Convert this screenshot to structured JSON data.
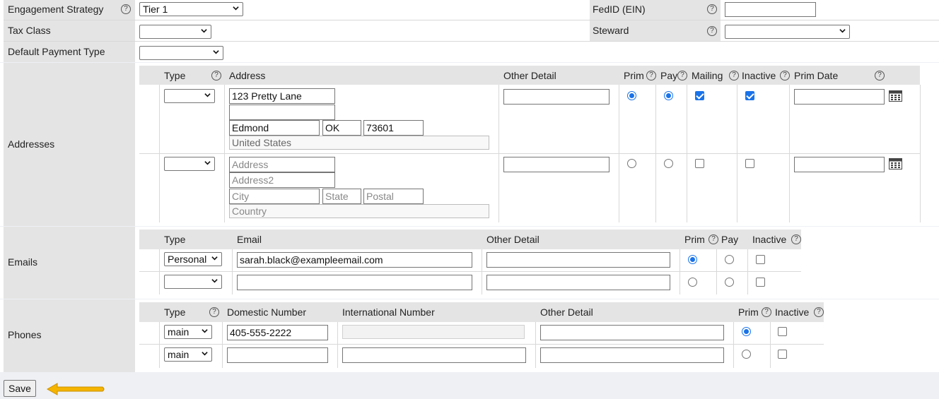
{
  "fields": {
    "engagement_strategy": {
      "label": "Engagement Strategy",
      "value": "Tier 1"
    },
    "tax_class": {
      "label": "Tax Class",
      "value": ""
    },
    "default_payment_type": {
      "label": "Default Payment Type",
      "value": ""
    },
    "fed_id": {
      "label": "FedID (EIN)",
      "value": ""
    },
    "steward": {
      "label": "Steward",
      "value": ""
    }
  },
  "help_glyph": "?",
  "addresses": {
    "label": "Addresses",
    "headers": {
      "type": "Type",
      "address": "Address",
      "other": "Other Detail",
      "prim": "Prim",
      "pay": "Pay",
      "mailing": "Mailing",
      "inactive": "Inactive",
      "prim_date": "Prim Date"
    },
    "rows": [
      {
        "type": "",
        "address": "123 Pretty Lane",
        "address2": "",
        "city": "Edmond",
        "state": "OK",
        "postal": "73601",
        "country": "United States",
        "other": "",
        "prim": true,
        "pay": true,
        "mailing": true,
        "inactive": true,
        "prim_date": ""
      },
      {
        "type": "",
        "address": "",
        "address2": "",
        "city": "",
        "state": "",
        "postal": "",
        "country": "",
        "other": "",
        "prim": false,
        "pay": false,
        "mailing": false,
        "inactive": false,
        "prim_date": ""
      }
    ],
    "placeholders": {
      "address": "Address",
      "address2": "Address2",
      "city": "City",
      "state": "State",
      "postal": "Postal",
      "country": "Country"
    }
  },
  "emails": {
    "label": "Emails",
    "headers": {
      "type": "Type",
      "email": "Email",
      "other": "Other Detail",
      "prim": "Prim",
      "pay": "Pay",
      "inactive": "Inactive"
    },
    "rows": [
      {
        "type": "Personal",
        "email": "sarah.black@exampleemail.com",
        "other": "",
        "prim": true,
        "pay": false,
        "inactive": false
      },
      {
        "type": "",
        "email": "",
        "other": "",
        "prim": false,
        "pay": false,
        "inactive": false
      }
    ]
  },
  "phones": {
    "label": "Phones",
    "headers": {
      "type": "Type",
      "domestic": "Domestic Number",
      "international": "International Number",
      "other": "Other Detail",
      "prim": "Prim",
      "inactive": "Inactive"
    },
    "rows": [
      {
        "type": "main",
        "domestic": "405-555-2222",
        "international": "",
        "other": "",
        "prim": true,
        "inactive": false
      },
      {
        "type": "main",
        "domestic": "",
        "international": "",
        "other": "",
        "prim": false,
        "inactive": false
      }
    ]
  },
  "save_label": "Save",
  "colors": {
    "accent": "#1a73e8",
    "label_bg": "#e4e4e4",
    "arrow": "#f5b400"
  }
}
